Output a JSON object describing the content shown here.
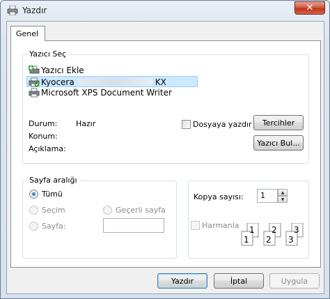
{
  "window": {
    "title": "Yazdır",
    "close_label": "✕"
  },
  "tabs": [
    {
      "label": "Genel"
    }
  ],
  "select_printer": {
    "group_label": "Yazıcı Seç",
    "printers": [
      {
        "label": "Yazıcı Ekle",
        "icon": "add-printer-icon"
      },
      {
        "label_prefix": "Kyocera",
        "label_suffix": "KX",
        "icon": "default-printer-icon",
        "selected": true
      },
      {
        "label": "Microsoft XPS Document Writer",
        "icon": "printer-icon"
      }
    ],
    "status_label": "Durum:",
    "status_value": "Hazır",
    "location_label": "Konum:",
    "comment_label": "Açıklama:",
    "print_to_file_label": "Dosyaya yazdır",
    "preferences_label": "Tercihler",
    "find_printer_label": "Yazıcı Bul..."
  },
  "page_range": {
    "group_label": "Sayfa aralığı",
    "all_label": "Tümü",
    "selection_label": "Seçim",
    "current_page_label": "Geçerli sayfa",
    "pages_label": "Sayfa:",
    "pages_value": ""
  },
  "copies": {
    "count_label": "Kopya sayısı:",
    "count_value": "1",
    "collate_label": "Harmanla",
    "collate_pages": [
      "1",
      "1",
      "2",
      "2",
      "3",
      "3"
    ]
  },
  "buttons": {
    "print": "Yazdır",
    "cancel": "İptal",
    "apply": "Uygula"
  }
}
